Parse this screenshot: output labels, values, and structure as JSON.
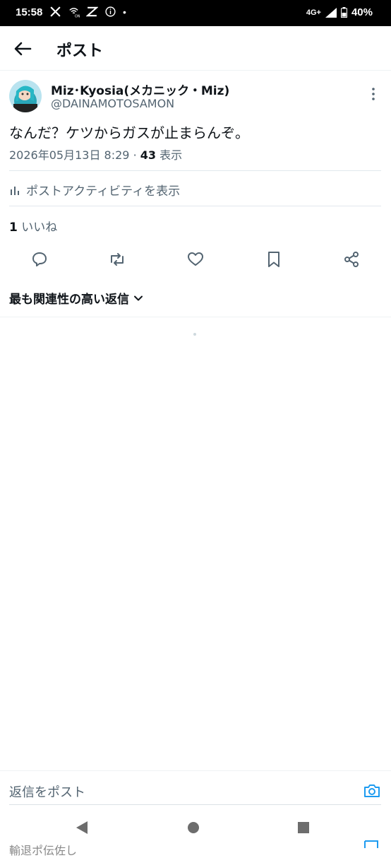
{
  "status_bar": {
    "time": "15:58",
    "network": "4G+",
    "battery": "40%",
    "dot": "•",
    "icons": [
      "x-logo-icon",
      "wifi-calling-icon",
      "capcut-icon",
      "info-icon"
    ]
  },
  "header": {
    "title": "ポスト"
  },
  "post": {
    "author_name": "Miz･Kyosia(メカニック・Miz)",
    "author_handle": "@DAINAMOTOSAMON",
    "text": "なんだ？ケツからガスが止まらんぞ。",
    "timestamp": "2026年05月13日 8:29",
    "separator": "·",
    "views_count": "43",
    "views_label": "表示",
    "activity_label": "ポストアクティビティを表示",
    "likes_count": "1",
    "likes_label": "いいね"
  },
  "replies": {
    "sort_label": "最も関連性の高い返信"
  },
  "compose": {
    "placeholder": "返信をポスト",
    "cutoff_text": "輸退ポ伝佐し"
  },
  "colors": {
    "text": "#0f1419",
    "secondary": "#536471",
    "accent": "#1d9bf0"
  }
}
